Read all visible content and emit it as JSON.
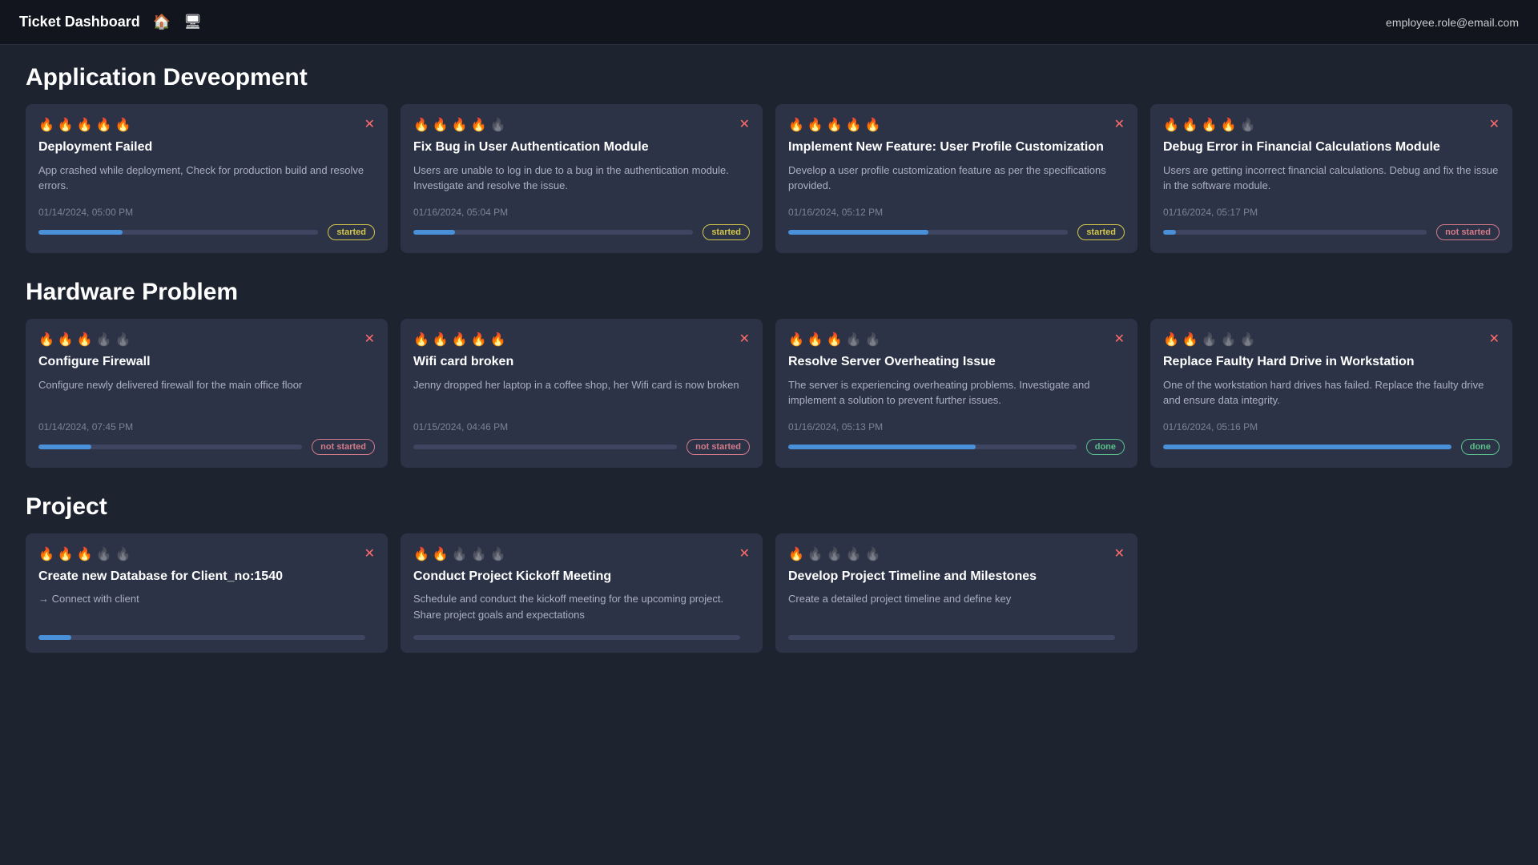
{
  "header": {
    "title": "Ticket Dashboard",
    "home_icon": "🏠",
    "monitor_icon": "🖥",
    "email": "employee.role@email.com"
  },
  "sections": [
    {
      "id": "app-dev",
      "title": "Application Deveopment",
      "cards": [
        {
          "id": "card-1",
          "priority_active": 5,
          "priority_total": 5,
          "title": "Deployment Failed",
          "description": "App crashed while deployment, Check for production build and resolve errors.",
          "date": "01/14/2024, 05:00 PM",
          "progress": 30,
          "status": "started",
          "status_class": "status-started"
        },
        {
          "id": "card-2",
          "priority_active": 4,
          "priority_total": 5,
          "title": "Fix Bug in User Authentication Module",
          "description": "Users are unable to log in due to a bug in the authentication module. Investigate and resolve the issue.",
          "date": "01/16/2024, 05:04 PM",
          "progress": 15,
          "status": "started",
          "status_class": "status-started"
        },
        {
          "id": "card-3",
          "priority_active": 5,
          "priority_total": 5,
          "title": "Implement New Feature: User Profile Customization",
          "description": "Develop a user profile customization feature as per the specifications provided.",
          "date": "01/16/2024, 05:12 PM",
          "progress": 50,
          "status": "started",
          "status_class": "status-started"
        },
        {
          "id": "card-4",
          "priority_active": 4,
          "priority_total": 5,
          "title": "Debug Error in Financial Calculations Module",
          "description": "Users are getting incorrect financial calculations. Debug and fix the issue in the software module.",
          "date": "01/16/2024, 05:17 PM",
          "progress": 5,
          "status": "not started",
          "status_class": "status-not-started"
        }
      ]
    },
    {
      "id": "hardware",
      "title": "Hardware Problem",
      "cards": [
        {
          "id": "card-5",
          "priority_active": 3,
          "priority_total": 5,
          "title": "Configure Firewall",
          "description": "Configure newly delivered firewall for the main office floor",
          "date": "01/14/2024, 07:45 PM",
          "progress": 20,
          "status": "not started",
          "status_class": "status-not-started"
        },
        {
          "id": "card-6",
          "priority_active": 5,
          "priority_total": 5,
          "title": "Wifi card broken",
          "description": "Jenny dropped her laptop in a coffee shop, her Wifi card is now broken",
          "date": "01/15/2024, 04:46 PM",
          "progress": 0,
          "status": "not started",
          "status_class": "status-not-started"
        },
        {
          "id": "card-7",
          "priority_active": 3,
          "priority_total": 5,
          "title": "Resolve Server Overheating Issue",
          "description": "The server is experiencing overheating problems. Investigate and implement a solution to prevent further issues.",
          "date": "01/16/2024, 05:13 PM",
          "progress": 65,
          "status": "done",
          "status_class": "status-done"
        },
        {
          "id": "card-8",
          "priority_active": 2,
          "priority_total": 5,
          "title": "Replace Faulty Hard Drive in Workstation",
          "description": "One of the workstation hard drives has failed. Replace the faulty drive and ensure data integrity.",
          "date": "01/16/2024, 05:16 PM",
          "progress": 100,
          "status": "done",
          "status_class": "status-done"
        }
      ]
    },
    {
      "id": "project",
      "title": "Project",
      "cards": [
        {
          "id": "card-9",
          "priority_active": 3,
          "priority_total": 5,
          "title": "Create new Database for Client_no:1540",
          "description": "→ Connect with client",
          "date": "",
          "progress": 10,
          "status": "",
          "status_class": "",
          "is_arrow": true
        },
        {
          "id": "card-10",
          "priority_active": 2,
          "priority_total": 5,
          "title": "Conduct Project Kickoff Meeting",
          "description": "Schedule and conduct the kickoff meeting for the upcoming project. Share project goals and expectations",
          "date": "",
          "progress": 0,
          "status": "",
          "status_class": ""
        },
        {
          "id": "card-11",
          "priority_active": 1,
          "priority_total": 5,
          "title": "Develop Project Timeline and Milestones",
          "description": "Create a detailed project timeline and define key",
          "date": "",
          "progress": 0,
          "status": "",
          "status_class": ""
        }
      ]
    }
  ]
}
